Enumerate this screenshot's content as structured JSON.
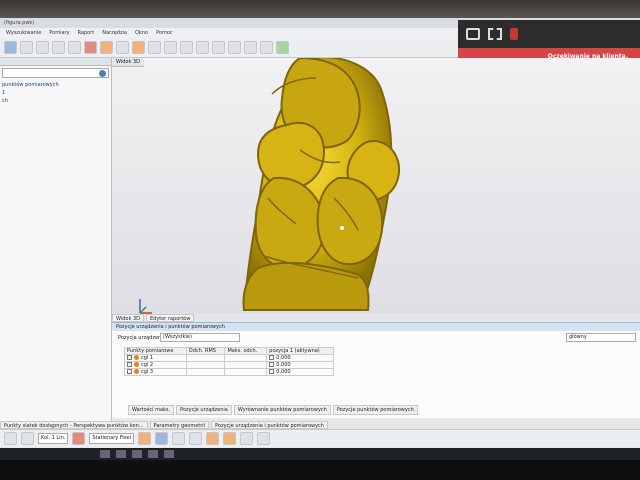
{
  "window": {
    "title": "(figura.pwk)"
  },
  "menu": [
    "Wyszukiwanie",
    "Pomiary",
    "Raport",
    "Narzędzia",
    "Okno",
    "Pomoc"
  ],
  "status": {
    "alert_text": "Oczekiwanie na klienta."
  },
  "left_panel": {
    "items": [
      "punktów pomiarowych",
      "1",
      "ch"
    ]
  },
  "viewport": {
    "tab_label": "Widok 3D",
    "view_tabs": [
      "Widok 3D",
      "Edytor raportów"
    ]
  },
  "measurement_panel": {
    "title": "Pozycje urządzenia i punktów pomiarowych",
    "selector_label": "Pozycja urządzenia",
    "selector_value": "(Wszystkie)",
    "right_selector_value": "główny",
    "columns": [
      "Punkty pomiarowe",
      "Odch. RMS",
      "Maks. odch.",
      "pozycja 1 (aktywna)"
    ],
    "rows": [
      {
        "name": "cgl 1",
        "value": "0.000"
      },
      {
        "name": "cgl 2",
        "value": "0.000"
      },
      {
        "name": "cgl 3",
        "value": "0.000"
      }
    ],
    "bottom_tabs": [
      "Wartości maks.",
      "Pozycje urządzenia",
      "Wyrównanie punktów pomiarowych",
      "Pozycje punktów pomiarowych"
    ]
  },
  "page_tabs": [
    "Punkty siatek dostępnych - Perspektywa punktów kon...",
    "Parametry geometrii",
    "Pozycje urządzenia i punktów pomiarowych"
  ],
  "bottom_toolbar": {
    "left_select": "Kol. 1 Lin.",
    "right_select": "Stationary Fixel"
  }
}
